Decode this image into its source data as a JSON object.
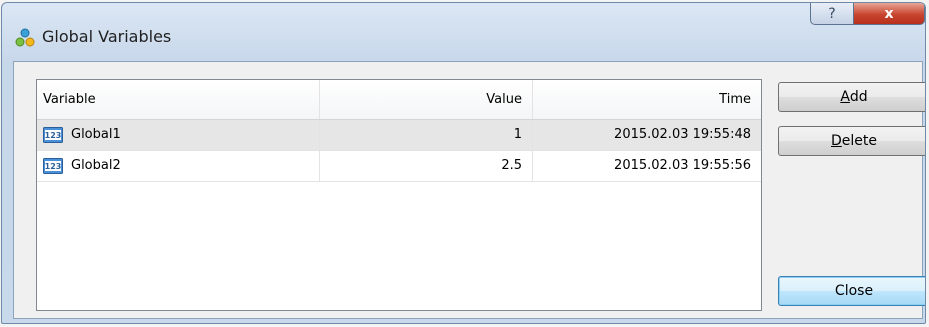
{
  "window": {
    "title": "Global Variables",
    "icon": "global-variables-icon",
    "help_glyph": "?",
    "close_glyph": "x"
  },
  "table": {
    "columns": [
      "Variable",
      "Value",
      "Time"
    ],
    "rows": [
      {
        "icon": "number-123-icon",
        "variable": "Global1",
        "value": "1",
        "time": "2015.02.03 19:55:48",
        "selected": true
      },
      {
        "icon": "number-123-icon",
        "variable": "Global2",
        "value": "2.5",
        "time": "2015.02.03 19:55:56",
        "selected": false
      }
    ]
  },
  "buttons": {
    "add": {
      "mnemonic": "A",
      "rest": "dd"
    },
    "delete": {
      "mnemonic": "D",
      "rest": "elete"
    },
    "close": {
      "label": "Close"
    }
  },
  "colors": {
    "title_bar": "#c7d7ea",
    "close_button": "#c8452f",
    "selected_row": "#e6e6e6",
    "default_button_border": "#3c7fb1"
  }
}
